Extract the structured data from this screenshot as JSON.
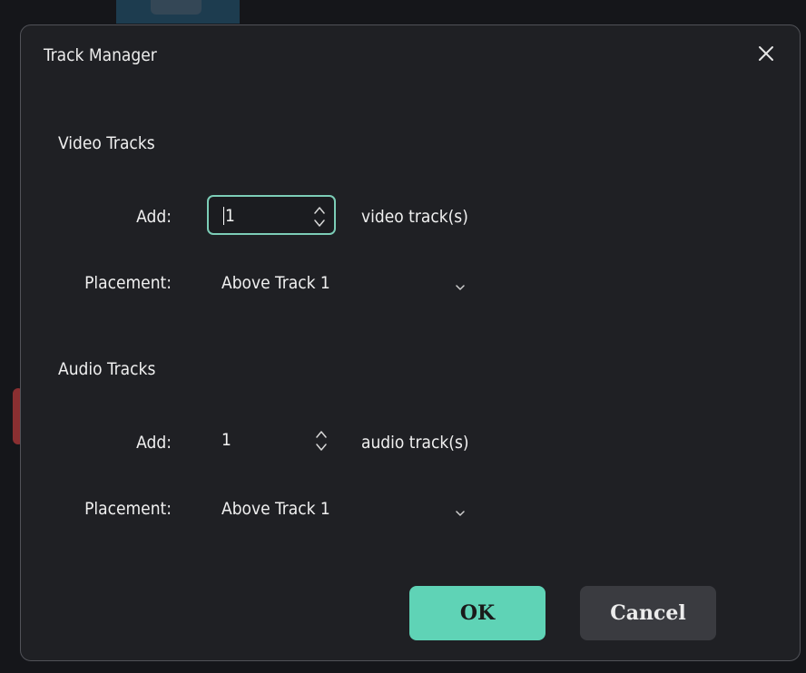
{
  "dialog": {
    "title": "Track Manager",
    "close_icon": "close-icon"
  },
  "video": {
    "section_title": "Video Tracks",
    "add_label": "Add:",
    "add_value": "1",
    "unit": "video track(s)",
    "placement_label": "Placement:",
    "placement_value": "Above Track 1"
  },
  "audio": {
    "section_title": "Audio Tracks",
    "add_label": "Add:",
    "add_value": "1",
    "unit": "audio track(s)",
    "placement_label": "Placement:",
    "placement_value": "Above Track 1"
  },
  "buttons": {
    "ok": "OK",
    "cancel": "Cancel"
  },
  "colors": {
    "accent": "#5fd3b6",
    "focus_border": "#7ccdb7",
    "dialog_bg": "#1f2024",
    "cancel_bg": "#3a3b40"
  }
}
